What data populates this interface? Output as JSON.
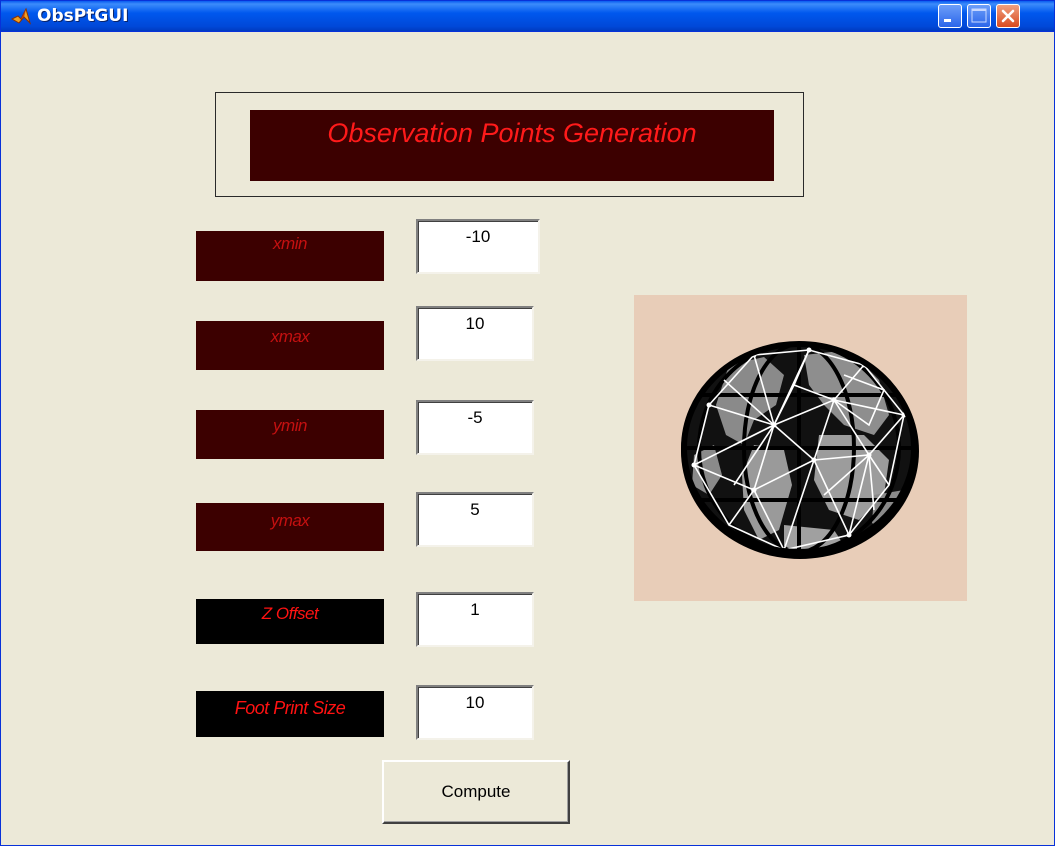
{
  "window": {
    "title": "ObsPtGUI",
    "app_icon": "matlab-icon",
    "controls": [
      "minimize-icon",
      "maximize-icon",
      "close-icon"
    ]
  },
  "header": {
    "title": "Observation Points Generation",
    "text_color": "#ff1a1a",
    "banner_color": "#3c0000"
  },
  "fields": [
    {
      "label": "xmin",
      "value": "-10"
    },
    {
      "label": "xmax",
      "value": "10"
    },
    {
      "label": "ymin",
      "value": "-5"
    },
    {
      "label": "ymax",
      "value": "5"
    },
    {
      "label": "Z Offset",
      "value": "1"
    },
    {
      "label": "Foot Print Size",
      "value": "10"
    }
  ],
  "compute_button": {
    "label": "Compute"
  },
  "image": {
    "icon": "globe-icon",
    "background": "#e8cdb8"
  }
}
